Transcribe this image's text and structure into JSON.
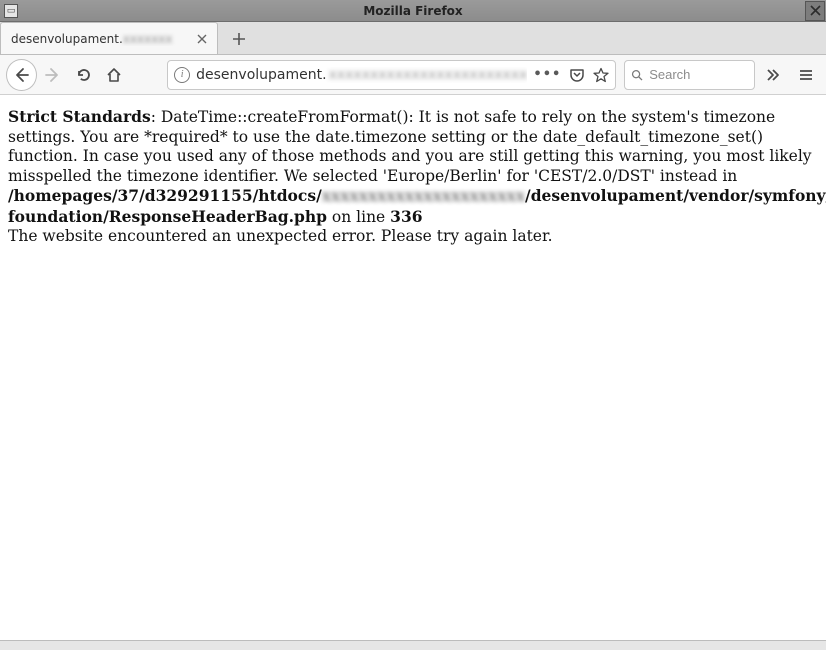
{
  "window": {
    "title": "Mozilla Firefox"
  },
  "tab": {
    "label_visible": "desenvolupament.",
    "label_obscured": "xxxxxxx"
  },
  "url": {
    "visible": "desenvolupament.",
    "obscured": "xxxxxxxxxxxxxxxxxxxxxxxx"
  },
  "search": {
    "placeholder": "Search"
  },
  "error": {
    "strict_label": "Strict Standards",
    "msg_part1": ": DateTime::createFromFormat(): It is not safe to rely on the system's timezone settings. You are *required* to use the date.timezone setting or the date_default_timezone_set() function. In case you used any of those methods and you are still getting this warning, you most likely misspelled the timezone identifier. We selected 'Europe/Berlin' for 'CEST/2.0/DST' instead in ",
    "path_part1": "/homepages/37/d329291155/htdocs/",
    "path_obscured": "xxxxxxxxxxxxxxxxxxxxxx",
    "path_part2": "/desenvolupament/vendor/symfony/http-foundation/ResponseHeaderBag.php",
    "online_label": " on line ",
    "line_number": "336",
    "generic_error": "The website encountered an unexpected error. Please try again later."
  }
}
